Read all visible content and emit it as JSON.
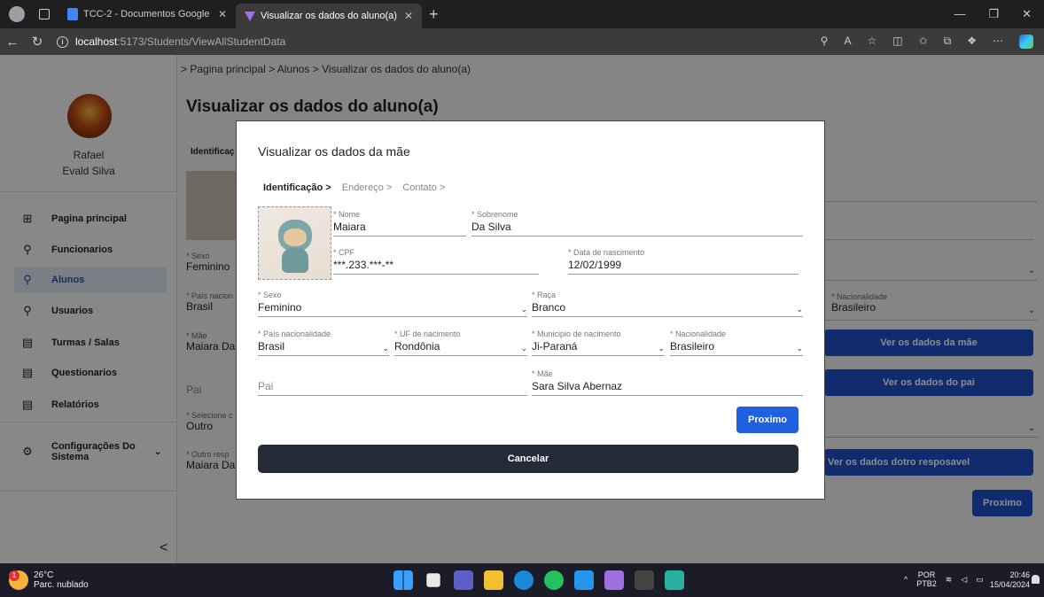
{
  "browser": {
    "tabs": [
      {
        "title": "TCC-2 - Documentos Google",
        "active": false
      },
      {
        "title": "Visualizar os dados do aluno(a)",
        "active": true
      }
    ],
    "url_host": "localhost",
    "url_path": ":5173/Students/ViewAllStudentData"
  },
  "sidebar": {
    "user_first": "Rafael",
    "user_last": "Evald Silva",
    "items": [
      {
        "label": "Pagina principal",
        "icon": "grid-icon"
      },
      {
        "label": "Funcionarios",
        "icon": "person-icon"
      },
      {
        "label": "Alunos",
        "icon": "person-icon",
        "active": true
      },
      {
        "label": "Usuarios",
        "icon": "person-icon"
      },
      {
        "label": "Turmas / Salas",
        "icon": "document-icon"
      },
      {
        "label": "Questionarios",
        "icon": "document-icon"
      },
      {
        "label": "Relatórios",
        "icon": "document-icon"
      },
      {
        "label": "Configurações Do Sistema",
        "icon": "gear-icon"
      }
    ],
    "collapse_glyph": "<"
  },
  "page": {
    "breadcrumb": "> Pagina principal  > Alunos  > Visualizar os dados do aluno(a)",
    "title": "Visualizar os dados do aluno(a)",
    "tab_label": "Identificaç",
    "bg_fields": {
      "sexo_label": "* Sexo",
      "sexo_value": "Feminino",
      "pais_label": "* País nacion",
      "pais_value": "Brasil",
      "mae_label": "* Mãe",
      "mae_value": "Maiara Da",
      "pai_placeholder": "Pai",
      "selecione_label": "* Selecione c",
      "selecione_value": "Outro",
      "outro_label": "* Outro resp",
      "outro_value": "Maiara Da",
      "nacionalidade_label": "* Nacionalidade",
      "nacionalidade_value": "Brasileiro"
    },
    "buttons": {
      "ver_mae": "Ver os dados da mãe",
      "ver_pai": "Ver os dados do pai",
      "ver_outro": "Ver os dados dotro resposavel",
      "proximo": "Proximo"
    }
  },
  "modal": {
    "title": "Visualizar os dados da mãe",
    "steps": [
      "Identificação >",
      "Endereço >",
      "Contato >"
    ],
    "fields": {
      "nome": {
        "label": "* Nome",
        "value": "Maiara"
      },
      "sobrenome": {
        "label": "* Sobrenome",
        "value": "Da Silva"
      },
      "cpf": {
        "label": "* CPF",
        "value": "***.233.***-**"
      },
      "nascimento": {
        "label": "* Data de nascimento",
        "value": "12/02/1999"
      },
      "sexo": {
        "label": "* Sexo",
        "value": "Feminino"
      },
      "raca": {
        "label": "* Raça",
        "value": "Branco"
      },
      "pais": {
        "label": "* País nacionalidade",
        "value": "Brasil"
      },
      "uf": {
        "label": "* UF de nacimento",
        "value": "Rondônia"
      },
      "municipio": {
        "label": "* Municipio de nacimento",
        "value": "Ji-Paraná"
      },
      "nacionalidade": {
        "label": "* Nacionalidade",
        "value": "Brasileiro"
      },
      "pai": {
        "placeholder": "Pai"
      },
      "mae": {
        "label": "* Mãe",
        "value": "Sara Silva Abernaz"
      }
    },
    "next_label": "Proximo",
    "cancel_label": "Cancelar"
  },
  "taskbar": {
    "temp": "26°C",
    "weather": "Parc. nublado",
    "weather_badge": "1",
    "lang_top": "POR",
    "lang_bottom": "PTB2",
    "time": "20:46",
    "date": "15/04/2024"
  }
}
